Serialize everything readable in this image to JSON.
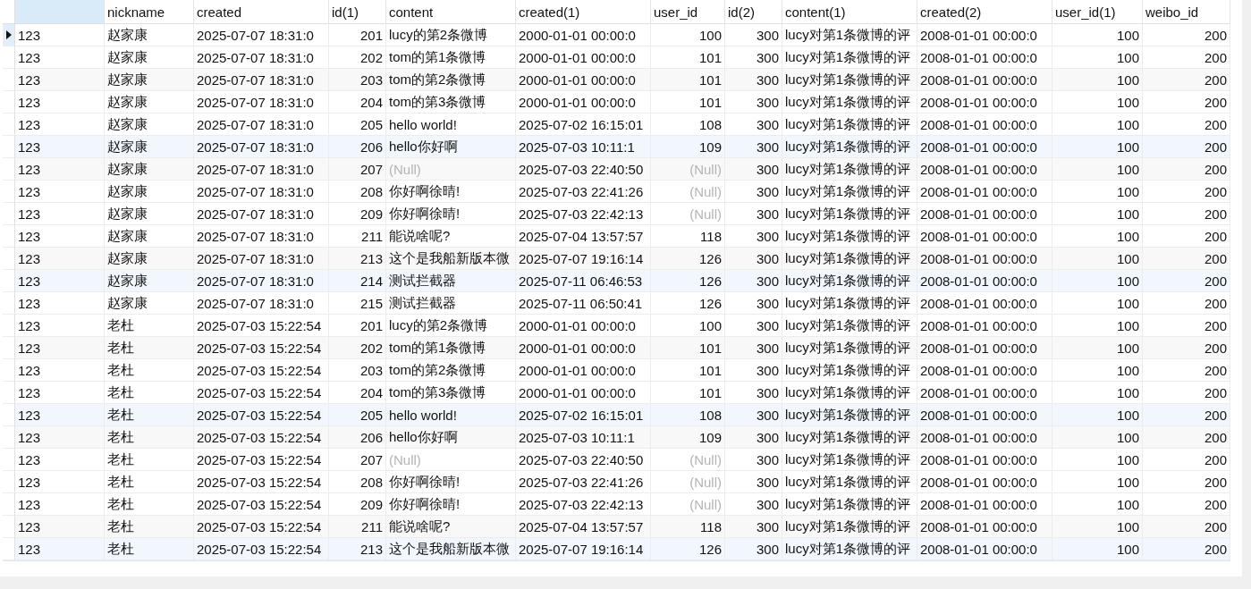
{
  "columns": [
    {
      "kind": "text"
    },
    {
      "label": "nickname",
      "kind": "text"
    },
    {
      "label": "created",
      "kind": "text"
    },
    {
      "label": "id(1)",
      "kind": "number"
    },
    {
      "label": "content",
      "kind": "text"
    },
    {
      "label": "created(1)",
      "kind": "text"
    },
    {
      "label": "user_id",
      "kind": "number"
    },
    {
      "label": "id(2)",
      "kind": "number"
    },
    {
      "label": "content(1)",
      "kind": "text"
    },
    {
      "label": "created(2)",
      "kind": "text"
    },
    {
      "label": "user_id(1)",
      "kind": "number"
    },
    {
      "label": "weibo_id",
      "kind": "number"
    }
  ],
  "rows": [
    {
      "selected": true,
      "cells": [
        "123",
        "赵家康",
        "2025-07-07 18:31:0",
        "201",
        "lucy的第2条微博",
        "2000-01-01 00:00:0",
        "100",
        "300",
        "lucy对第1条微博的评",
        "2008-01-01 00:00:0",
        "100",
        "200"
      ]
    },
    {
      "selected": false,
      "cells": [
        "123",
        "赵家康",
        "2025-07-07 18:31:0",
        "202",
        "tom的第1条微博",
        "2000-01-01 00:00:0",
        "101",
        "300",
        "lucy对第1条微博的评",
        "2008-01-01 00:00:0",
        "100",
        "200"
      ]
    },
    {
      "selected": false,
      "cells": [
        "123",
        "赵家康",
        "2025-07-07 18:31:0",
        "203",
        "tom的第2条微博",
        "2000-01-01 00:00:0",
        "101",
        "300",
        "lucy对第1条微博的评",
        "2008-01-01 00:00:0",
        "100",
        "200"
      ]
    },
    {
      "selected": false,
      "cells": [
        "123",
        "赵家康",
        "2025-07-07 18:31:0",
        "204",
        "tom的第3条微博",
        "2000-01-01 00:00:0",
        "101",
        "300",
        "lucy对第1条微博的评",
        "2008-01-01 00:00:0",
        "100",
        "200"
      ]
    },
    {
      "selected": false,
      "cells": [
        "123",
        "赵家康",
        "2025-07-07 18:31:0",
        "205",
        "hello world!",
        "2025-07-02 16:15:01",
        "108",
        "300",
        "lucy对第1条微博的评",
        "2008-01-01 00:00:0",
        "100",
        "200"
      ]
    },
    {
      "selected": false,
      "cells": [
        "123",
        "赵家康",
        "2025-07-07 18:31:0",
        "206",
        "hello你好啊",
        "2025-07-03 10:11:1",
        "109",
        "300",
        "lucy对第1条微博的评",
        "2008-01-01 00:00:0",
        "100",
        "200"
      ]
    },
    {
      "selected": false,
      "cells": [
        "123",
        "赵家康",
        "2025-07-07 18:31:0",
        "207",
        {
          "text": "(Null)",
          "null": true
        },
        "2025-07-03 22:40:50",
        {
          "text": "(Null)",
          "null": true
        },
        "300",
        "lucy对第1条微博的评",
        "2008-01-01 00:00:0",
        "100",
        "200"
      ]
    },
    {
      "selected": false,
      "cells": [
        "123",
        "赵家康",
        "2025-07-07 18:31:0",
        "208",
        "你好啊徐晴!",
        "2025-07-03 22:41:26",
        {
          "text": "(Null)",
          "null": true
        },
        "300",
        "lucy对第1条微博的评",
        "2008-01-01 00:00:0",
        "100",
        "200"
      ]
    },
    {
      "selected": false,
      "cells": [
        "123",
        "赵家康",
        "2025-07-07 18:31:0",
        "209",
        "你好啊徐晴!",
        "2025-07-03 22:42:13",
        {
          "text": "(Null)",
          "null": true
        },
        "300",
        "lucy对第1条微博的评",
        "2008-01-01 00:00:0",
        "100",
        "200"
      ]
    },
    {
      "selected": false,
      "cells": [
        "123",
        "赵家康",
        "2025-07-07 18:31:0",
        "211",
        "能说啥呢?",
        "2025-07-04 13:57:57",
        "118",
        "300",
        "lucy对第1条微博的评",
        "2008-01-01 00:00:0",
        "100",
        "200"
      ]
    },
    {
      "selected": false,
      "cells": [
        "123",
        "赵家康",
        "2025-07-07 18:31:0",
        "213",
        "这个是我船新版本微",
        "2025-07-07 19:16:14",
        "126",
        "300",
        "lucy对第1条微博的评",
        "2008-01-01 00:00:0",
        "100",
        "200"
      ]
    },
    {
      "selected": false,
      "cells": [
        "123",
        "赵家康",
        "2025-07-07 18:31:0",
        "214",
        "测试拦截器",
        "2025-07-11 06:46:53",
        "126",
        "300",
        "lucy对第1条微博的评",
        "2008-01-01 00:00:0",
        "100",
        "200"
      ]
    },
    {
      "selected": false,
      "cells": [
        "123",
        "赵家康",
        "2025-07-07 18:31:0",
        "215",
        "测试拦截器",
        "2025-07-11 06:50:41",
        "126",
        "300",
        "lucy对第1条微博的评",
        "2008-01-01 00:00:0",
        "100",
        "200"
      ]
    },
    {
      "selected": false,
      "cells": [
        "123",
        "老杜",
        "2025-07-03 15:22:54",
        "201",
        "lucy的第2条微博",
        "2000-01-01 00:00:0",
        "100",
        "300",
        "lucy对第1条微博的评",
        "2008-01-01 00:00:0",
        "100",
        "200"
      ]
    },
    {
      "selected": false,
      "cells": [
        "123",
        "老杜",
        "2025-07-03 15:22:54",
        "202",
        "tom的第1条微博",
        "2000-01-01 00:00:0",
        "101",
        "300",
        "lucy对第1条微博的评",
        "2008-01-01 00:00:0",
        "100",
        "200"
      ]
    },
    {
      "selected": false,
      "cells": [
        "123",
        "老杜",
        "2025-07-03 15:22:54",
        "203",
        "tom的第2条微博",
        "2000-01-01 00:00:0",
        "101",
        "300",
        "lucy对第1条微博的评",
        "2008-01-01 00:00:0",
        "100",
        "200"
      ]
    },
    {
      "selected": false,
      "cells": [
        "123",
        "老杜",
        "2025-07-03 15:22:54",
        "204",
        "tom的第3条微博",
        "2000-01-01 00:00:0",
        "101",
        "300",
        "lucy对第1条微博的评",
        "2008-01-01 00:00:0",
        "100",
        "200"
      ]
    },
    {
      "selected": false,
      "cells": [
        "123",
        "老杜",
        "2025-07-03 15:22:54",
        "205",
        "hello world!",
        "2025-07-02 16:15:01",
        "108",
        "300",
        "lucy对第1条微博的评",
        "2008-01-01 00:00:0",
        "100",
        "200"
      ]
    },
    {
      "selected": false,
      "cells": [
        "123",
        "老杜",
        "2025-07-03 15:22:54",
        "206",
        "hello你好啊",
        "2025-07-03 10:11:1",
        "109",
        "300",
        "lucy对第1条微博的评",
        "2008-01-01 00:00:0",
        "100",
        "200"
      ]
    },
    {
      "selected": false,
      "cells": [
        "123",
        "老杜",
        "2025-07-03 15:22:54",
        "207",
        {
          "text": "(Null)",
          "null": true
        },
        "2025-07-03 22:40:50",
        {
          "text": "(Null)",
          "null": true
        },
        "300",
        "lucy对第1条微博的评",
        "2008-01-01 00:00:0",
        "100",
        "200"
      ]
    },
    {
      "selected": false,
      "cells": [
        "123",
        "老杜",
        "2025-07-03 15:22:54",
        "208",
        "你好啊徐晴!",
        "2025-07-03 22:41:26",
        {
          "text": "(Null)",
          "null": true
        },
        "300",
        "lucy对第1条微博的评",
        "2008-01-01 00:00:0",
        "100",
        "200"
      ]
    },
    {
      "selected": false,
      "cells": [
        "123",
        "老杜",
        "2025-07-03 15:22:54",
        "209",
        "你好啊徐晴!",
        "2025-07-03 22:42:13",
        {
          "text": "(Null)",
          "null": true
        },
        "300",
        "lucy对第1条微博的评",
        "2008-01-01 00:00:0",
        "100",
        "200"
      ]
    },
    {
      "selected": false,
      "cells": [
        "123",
        "老杜",
        "2025-07-03 15:22:54",
        "211",
        "能说啥呢?",
        "2025-07-04 13:57:57",
        "118",
        "300",
        "lucy对第1条微博的评",
        "2008-01-01 00:00:0",
        "100",
        "200"
      ]
    },
    {
      "selected": false,
      "cells": [
        "123",
        "老杜",
        "2025-07-03 15:22:54",
        "213",
        "这个是我船新版本微",
        "2025-07-07 19:16:14",
        "126",
        "300",
        "lucy对第1条微博的评",
        "2008-01-01 00:00:0",
        "100",
        "200"
      ]
    }
  ]
}
